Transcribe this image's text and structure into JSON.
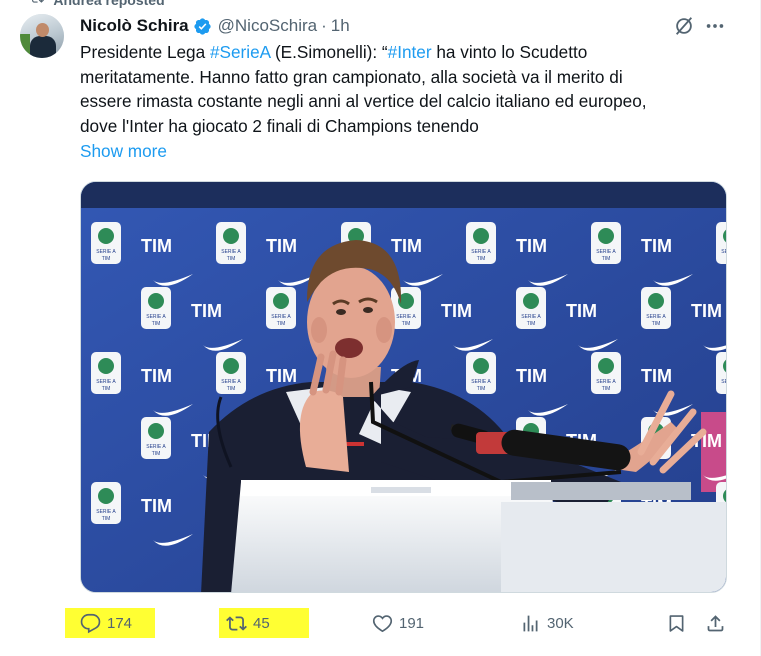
{
  "repost_banner": {
    "text": "Andrea reposted"
  },
  "tweet": {
    "author": {
      "display_name": "Nicolò Schira",
      "handle": "@NicoSchira",
      "separator": "·",
      "time": "1h",
      "verified": true
    },
    "text_lines": [
      {
        "segments": [
          {
            "t": "Presidente Lega ",
            "tag": false
          },
          {
            "t": "#SerieA",
            "tag": true
          },
          {
            "t": " (E.Simonelli): “",
            "tag": false
          },
          {
            "t": "#Inter",
            "tag": true
          },
          {
            "t": " ha vinto lo Scudetto",
            "tag": false
          }
        ]
      },
      {
        "segments": [
          {
            "t": "meritatamente. Hanno fatto gran campionato, alla società va il merito di",
            "tag": false
          }
        ]
      },
      {
        "segments": [
          {
            "t": "essere rimasta costante negli anni al vertice del calcio italiano ed europeo,",
            "tag": false
          }
        ]
      },
      {
        "segments": [
          {
            "t": "dove l'Inter ha giocato 2 finali di Champions tenendo",
            "tag": false
          }
        ]
      }
    ],
    "show_more": "Show more",
    "media": {
      "backdrop_text": [
        "TIM"
      ],
      "badge_text": [
        "SERIE A",
        "TIM"
      ],
      "colors": {
        "backdrop": "#2b4ea6",
        "podium": "#f3f5f7"
      }
    },
    "actions": {
      "reply_count": "174",
      "retweet_count": "45",
      "like_count": "191",
      "view_count": "30K",
      "highlight_color": "#ffff33"
    }
  },
  "colors": {
    "accent": "#1d9bf0",
    "secondary_text": "#536471",
    "verified": "#1d9bf0"
  },
  "icons": [
    "repost-icon",
    "verified-badge-icon",
    "grok-icon",
    "more-icon",
    "reply-icon",
    "retweet-icon",
    "like-icon",
    "views-icon",
    "bookmark-icon",
    "share-icon"
  ]
}
